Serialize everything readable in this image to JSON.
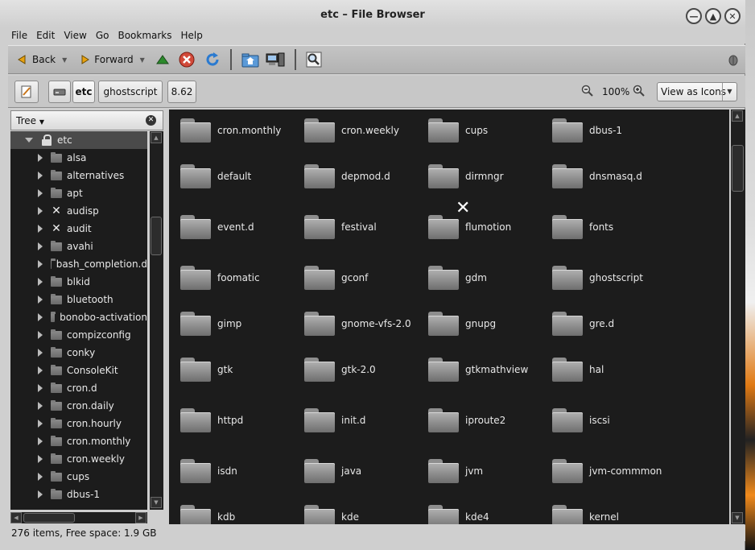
{
  "window": {
    "title": "etc – File Browser"
  },
  "menubar": {
    "items": [
      "File",
      "Edit",
      "View",
      "Go",
      "Bookmarks",
      "Help"
    ]
  },
  "toolbar": {
    "back_label": "Back",
    "forward_label": "Forward"
  },
  "location": {
    "crumbs": [
      "etc",
      "ghostscript",
      "8.62"
    ],
    "zoom": "100%",
    "view_mode": "View as Icons"
  },
  "sidebar": {
    "title": "Tree",
    "root": "etc",
    "items": [
      {
        "label": "alsa",
        "icon": "folder-icon"
      },
      {
        "label": "alternatives",
        "icon": "folder-icon"
      },
      {
        "label": "apt",
        "icon": "folder-icon"
      },
      {
        "label": "audisp",
        "icon": "unreadable-icon"
      },
      {
        "label": "audit",
        "icon": "unreadable-icon"
      },
      {
        "label": "avahi",
        "icon": "folder-icon"
      },
      {
        "label": "bash_completion.d",
        "icon": "folder-icon"
      },
      {
        "label": "blkid",
        "icon": "folder-icon"
      },
      {
        "label": "bluetooth",
        "icon": "folder-icon"
      },
      {
        "label": "bonobo-activation",
        "icon": "folder-icon"
      },
      {
        "label": "compizconfig",
        "icon": "folder-icon"
      },
      {
        "label": "conky",
        "icon": "folder-icon"
      },
      {
        "label": "ConsoleKit",
        "icon": "folder-icon"
      },
      {
        "label": "cron.d",
        "icon": "folder-icon"
      },
      {
        "label": "cron.daily",
        "icon": "folder-icon"
      },
      {
        "label": "cron.hourly",
        "icon": "folder-icon"
      },
      {
        "label": "cron.monthly",
        "icon": "folder-icon"
      },
      {
        "label": "cron.weekly",
        "icon": "folder-icon"
      },
      {
        "label": "cups",
        "icon": "folder-icon"
      },
      {
        "label": "dbus-1",
        "icon": "folder-icon"
      }
    ]
  },
  "files": [
    "cron.monthly",
    "cron.weekly",
    "cups",
    "dbus-1",
    "default",
    "depmod.d",
    "dirmngr",
    "dnsmasq.d",
    "event.d",
    "festival",
    "flumotion",
    "fonts",
    "foomatic",
    "gconf",
    "gdm",
    "ghostscript",
    "gimp",
    "gnome-vfs-2.0",
    "gnupg",
    "gre.d",
    "gtk",
    "gtk-2.0",
    "gtkmathview",
    "hal",
    "httpd",
    "init.d",
    "iproute2",
    "iscsi",
    "isdn",
    "java",
    "jvm",
    "jvm-commmon",
    "kdb",
    "kde",
    "kde4",
    "kernel"
  ],
  "status": {
    "text": "276 items, Free space: 1.9 GB"
  }
}
